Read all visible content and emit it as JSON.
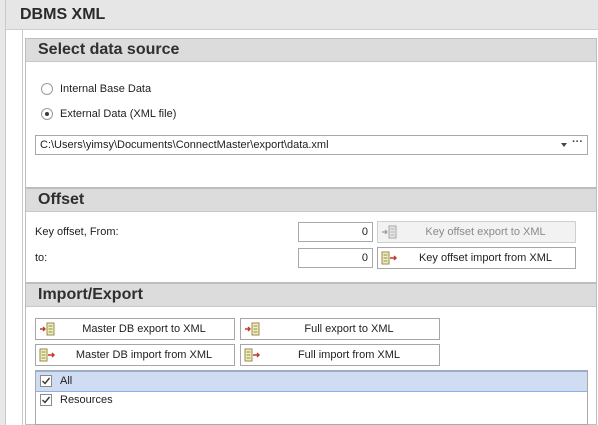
{
  "app": {
    "title": "DBMS XML"
  },
  "data_source": {
    "title": "Select data source",
    "options": [
      "Internal Base Data",
      "External Data (XML file)"
    ],
    "selected_index": 1,
    "path": "C:\\Users\\yimsy\\Documents\\ConnectMaster\\export\\data.xml"
  },
  "offset": {
    "title": "Offset",
    "from_label": "Key offset, From:",
    "to_label": "to:",
    "from_value": "0",
    "to_value": "0",
    "export_button": "Key offset export to XML",
    "import_button": "Key offset import from XML"
  },
  "import_export": {
    "title": "Import/Export",
    "master_export": "Master DB export to XML",
    "full_export": "Full export to XML",
    "master_import": "Master DB import from XML",
    "full_import": "Full import from XML",
    "items": [
      {
        "label": "All",
        "checked": true
      },
      {
        "label": "Resources",
        "checked": true
      }
    ]
  }
}
